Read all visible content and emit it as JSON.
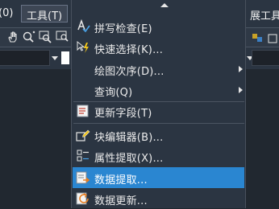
{
  "menubar": {
    "left_fragment": "(0)",
    "tools_label": "工具(T)",
    "right_fragment": "展工具("
  },
  "toolbar": {
    "icons": [
      "pan-hand-icon",
      "zoom-realtime-icon",
      "zoom-window-icon"
    ]
  },
  "menu": {
    "items": [
      {
        "label": "拼写检查(E)",
        "icon": "spell-check-icon"
      },
      {
        "label": "快速选择(K)...",
        "icon": "quick-select-icon"
      },
      {
        "label": "绘图次序(D)...",
        "icon": "",
        "submenu": true
      },
      {
        "label": "查询(Q)",
        "icon": "",
        "submenu": true
      },
      {
        "label": "更新字段(T)",
        "icon": "update-field-icon"
      },
      {
        "label": "块编辑器(B)...",
        "icon": "block-editor-icon"
      },
      {
        "label": "属性提取(X)...",
        "icon": "attribute-extract-icon"
      },
      {
        "label": "数据提取...",
        "icon": "data-extract-icon",
        "selected": true
      },
      {
        "label": "数据更新...",
        "icon": "data-update-icon"
      }
    ]
  },
  "colors": {
    "menu_bg": "#2b3542",
    "selection": "#2a86d1",
    "workspace": "#212830"
  }
}
